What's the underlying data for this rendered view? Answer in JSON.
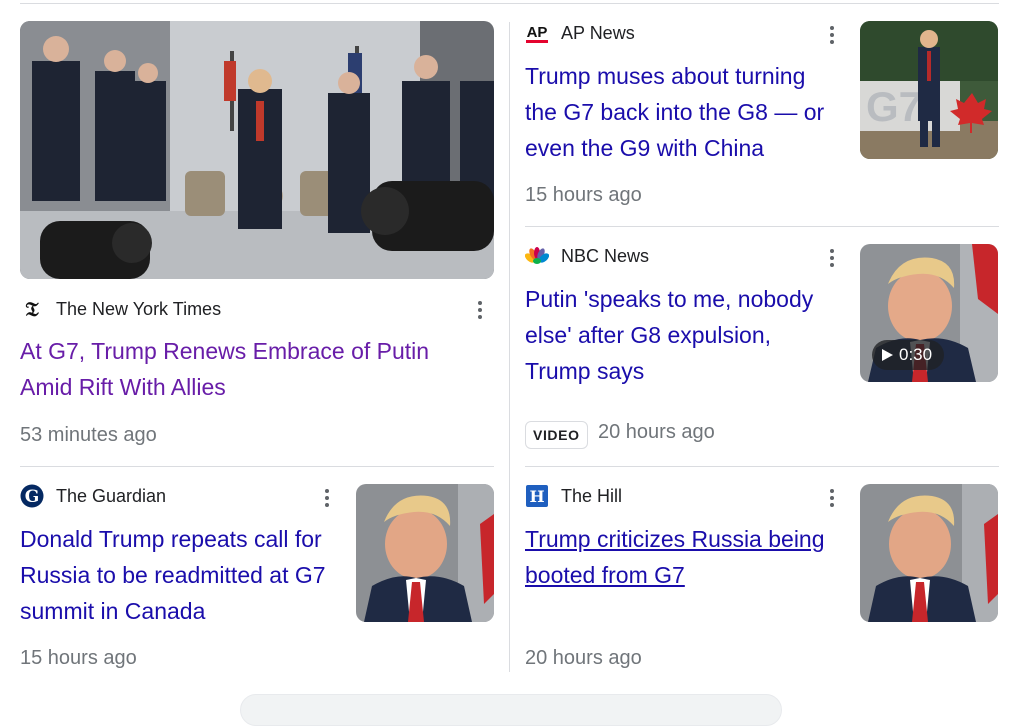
{
  "articles": [
    {
      "source": "The New York Times",
      "logo_icon": "nyt-logo-icon",
      "title": "At G7, Trump Renews Embrace of Putin Amid Rift With Allies",
      "title_lines": [
        "At G7, Trump Renews Embrace of Putin",
        "Amid Rift With Allies"
      ],
      "time": "53 minutes ago",
      "title_color": "#681da8"
    },
    {
      "source": "AP News",
      "logo_icon": "ap-logo-icon",
      "logo_text": "AP",
      "title_lines": [
        "Trump muses about turning",
        "the G7 back into the G8 — or",
        "even the G9 with China"
      ],
      "time": "15 hours ago",
      "thumb_text": "G7"
    },
    {
      "source": "NBC News",
      "logo_icon": "nbc-peacock-icon",
      "title_lines": [
        "Putin 'speaks to me, nobody",
        "else' after G8 expulsion,",
        "Trump says"
      ],
      "badge": "VIDEO",
      "time": "20 hours ago",
      "duration": "0:30"
    },
    {
      "source": "The Guardian",
      "logo_icon": "guardian-logo-icon",
      "title_lines": [
        "Donald Trump repeats call for",
        "Russia to be readmitted at G7",
        "summit in Canada"
      ],
      "time": "15 hours ago"
    },
    {
      "source": "The Hill",
      "logo_icon": "the-hill-logo-icon",
      "logo_text": "H",
      "title_lines": [
        "Trump criticizes Russia being",
        "booted from G7"
      ],
      "time": "20 hours ago"
    }
  ],
  "colors": {
    "link": "#1a0dab",
    "visited": "#681da8",
    "meta": "#70757a",
    "divider": "#dadce0"
  }
}
